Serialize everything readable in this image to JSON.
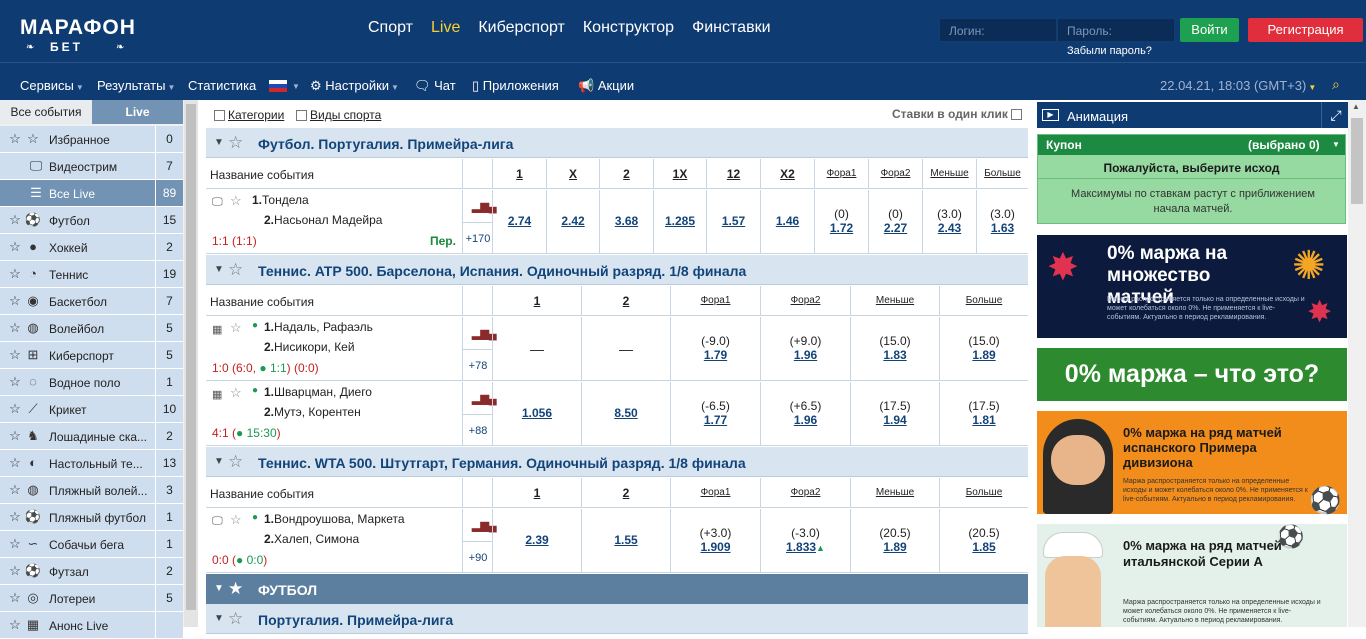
{
  "header": {
    "logo_line1": "МАРАФОН",
    "logo_line2": "БЕТ",
    "nav": [
      {
        "label": "Спорт",
        "active": false
      },
      {
        "label": "Live",
        "active": true
      },
      {
        "label": "Киберспорт",
        "active": false
      },
      {
        "label": "Конструктор",
        "active": false
      },
      {
        "label": "Финставки",
        "active": false
      }
    ],
    "login_placeholder": "Логин:",
    "password_placeholder": "Пароль:",
    "login_button": "Войти",
    "register_button": "Регистрация",
    "forgot_password": "Забыли пароль?"
  },
  "subnav": {
    "items": [
      "Сервисы",
      "Результаты",
      "Статистика",
      "Настройки",
      "Чат",
      "Приложения",
      "Акции"
    ],
    "datetime": "22.04.21, 18:03 (GMT+3)"
  },
  "left": {
    "tabs": [
      "Все события",
      "Live"
    ],
    "items": [
      {
        "label": "Избранное",
        "count": "0",
        "icon": "star-icon"
      },
      {
        "label": "Видеострим",
        "count": "7",
        "icon": "monitor-icon"
      },
      {
        "label": "Все Live",
        "count": "89",
        "icon": "list-icon"
      },
      {
        "label": "Футбол",
        "count": "15",
        "icon": "football-icon"
      },
      {
        "label": "Хоккей",
        "count": "2",
        "icon": "hockey-icon"
      },
      {
        "label": "Теннис",
        "count": "19",
        "icon": "tennis-icon"
      },
      {
        "label": "Баскетбол",
        "count": "7",
        "icon": "basketball-icon"
      },
      {
        "label": "Волейбол",
        "count": "5",
        "icon": "volleyball-icon"
      },
      {
        "label": "Киберспорт",
        "count": "5",
        "icon": "gamepad-icon"
      },
      {
        "label": "Водное поло",
        "count": "1",
        "icon": "water-polo-icon"
      },
      {
        "label": "Крикет",
        "count": "10",
        "icon": "cricket-icon"
      },
      {
        "label": "Лошадиные ска...",
        "count": "2",
        "icon": "horse-icon"
      },
      {
        "label": "Настольный те...",
        "count": "13",
        "icon": "table-tennis-icon"
      },
      {
        "label": "Пляжный волей...",
        "count": "3",
        "icon": "beach-volleyball-icon"
      },
      {
        "label": "Пляжный футбол",
        "count": "1",
        "icon": "beach-football-icon"
      },
      {
        "label": "Собачьи бега",
        "count": "1",
        "icon": "dog-icon"
      },
      {
        "label": "Футзал",
        "count": "2",
        "icon": "futsal-icon"
      },
      {
        "label": "Лотереи",
        "count": "5",
        "icon": "lottery-icon"
      },
      {
        "label": "Анонс Live",
        "count": "",
        "icon": "calendar-icon"
      }
    ]
  },
  "main": {
    "filters": [
      "Категории",
      "Виды спорта"
    ],
    "one_click": "Ставки в один клик",
    "name_header": "Название события",
    "sections": [
      {
        "title": "Футбол. Португалия. Примейра-лига",
        "cols": [
          "1",
          "X",
          "2",
          "1X",
          "12",
          "X2",
          "Фора1",
          "Фора2",
          "Меньше",
          "Больше"
        ],
        "events": [
          {
            "p1": "Тондела",
            "p2": "Насьонал Мадейра",
            "score_pre": "1:1 (1:1)",
            "score_live": "",
            "score_post": "",
            "extra": "Пер.",
            "more": "+170",
            "odds": [
              {
                "h": "",
                "o": "2.74"
              },
              {
                "h": "",
                "o": "2.42"
              },
              {
                "h": "",
                "o": "3.68"
              },
              {
                "h": "",
                "o": "1.285"
              },
              {
                "h": "",
                "o": "1.57"
              },
              {
                "h": "",
                "o": "1.46"
              },
              {
                "h": "(0)",
                "o": "1.72"
              },
              {
                "h": "(0)",
                "o": "2.27"
              },
              {
                "h": "(3.0)",
                "o": "2.43"
              },
              {
                "h": "(3.0)",
                "o": "1.63"
              }
            ]
          }
        ]
      },
      {
        "title": "Теннис. ATP 500. Барселона, Испания. Одиночный разряд. 1/8 финала",
        "cols": [
          "1",
          "2",
          "Фора1",
          "Фора2",
          "Меньше",
          "Больше"
        ],
        "events": [
          {
            "p1": "Надаль, Рафаэль",
            "p2": "Нисикори, Кей",
            "score_pre": "1:0 (6:0, ",
            "score_live": "1:1",
            "score_post": ") (0:0)",
            "extra": "",
            "more": "+78",
            "odds": [
              {
                "h": "",
                "o": "—"
              },
              {
                "h": "",
                "o": "—"
              },
              {
                "h": "(-9.0)",
                "o": "1.79"
              },
              {
                "h": "(+9.0)",
                "o": "1.96"
              },
              {
                "h": "(15.0)",
                "o": "1.83"
              },
              {
                "h": "(15.0)",
                "o": "1.89"
              }
            ]
          },
          {
            "p1": "Шварцман, Диего",
            "p2": "Мутэ, Корентен",
            "score_pre": "4:1 (",
            "score_live": "15:30",
            "score_post": ")",
            "extra": "",
            "more": "+88",
            "odds": [
              {
                "h": "",
                "o": "1.056"
              },
              {
                "h": "",
                "o": "8.50"
              },
              {
                "h": "(-6.5)",
                "o": "1.77"
              },
              {
                "h": "(+6.5)",
                "o": "1.96"
              },
              {
                "h": "(17.5)",
                "o": "1.94"
              },
              {
                "h": "(17.5)",
                "o": "1.81"
              }
            ]
          }
        ]
      },
      {
        "title": "Теннис. WTA 500. Штутгарт, Германия. Одиночный разряд. 1/8 финала",
        "cols": [
          "1",
          "2",
          "Фора1",
          "Фора2",
          "Меньше",
          "Больше"
        ],
        "events": [
          {
            "p1": "Вондроушова, Маркета",
            "p2": "Халеп, Симона",
            "score_pre": "0:0 (",
            "score_live": "0:0",
            "score_post": ")",
            "extra": "",
            "more": "+90",
            "odds": [
              {
                "h": "",
                "o": "2.39"
              },
              {
                "h": "",
                "o": "1.55"
              },
              {
                "h": "(+3.0)",
                "o": "1.909"
              },
              {
                "h": "(-3.0)",
                "o": "1.833"
              },
              {
                "h": "(20.5)",
                "o": "1.89"
              },
              {
                "h": "(20.5)",
                "o": "1.85"
              }
            ]
          }
        ]
      }
    ],
    "group_title": "ФУТБОЛ",
    "next_section": "Португалия. Примейра-лига"
  },
  "right": {
    "animation": "Анимация",
    "coupon_title": "Купон",
    "coupon_selected": "(выбрано 0)",
    "coupon_prompt": "Пожалуйста, выберите исход",
    "coupon_note": "Максимумы по ставкам растут с приближением начала матчей.",
    "banners": {
      "b1_title": "0% маржа на множество матчей",
      "b1_sub": "Маржа распространяется только на определенные исходы и может колебаться около 0%. Не применяется к live-событиям. Актуально в период рекламирования.",
      "b2_title": "0% маржа – что это?",
      "b3_title": "0% маржа на ряд матчей испанского Примера дивизиона",
      "b3_sub": "Маржа распространяется только на определенные исходы и может колебаться около 0%. Не применяется к live-событиям. Актуально в период рекламирования.",
      "b4_title": "0% маржа на ряд матчей итальянской Серии А",
      "b4_sub": "Маржа распространяется только на определенные исходы и может колебаться около 0%. Не применяется к live-событиям. Актуально в период рекламирования."
    }
  }
}
